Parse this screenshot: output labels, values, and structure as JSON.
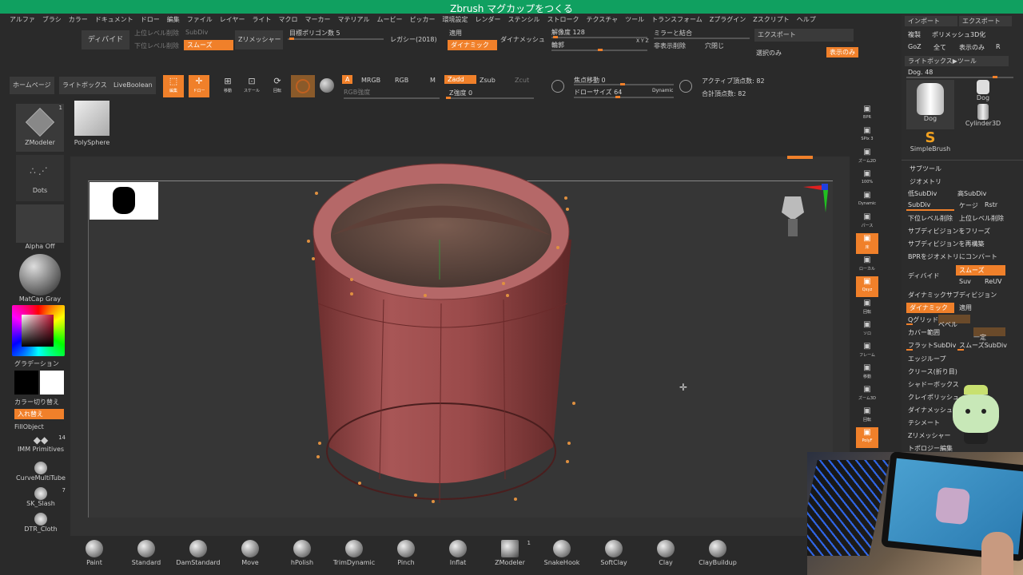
{
  "title_bar": {
    "title": "Zbrush マグカップをつくる",
    "bg": "#10a060"
  },
  "menu": [
    "アルファ",
    "ブラシ",
    "カラー",
    "ドキュメント",
    "ドロー",
    "編集",
    "ファイル",
    "レイヤー",
    "ライト",
    "マクロ",
    "マーカー",
    "マテリアル",
    "ムービー",
    "ピッカー",
    "環境設定",
    "レンダー",
    "ステンシル",
    "ストローク",
    "テクスチャ",
    "ツール",
    "トランスフォーム",
    "Zプラグイン",
    "Zスクリプト",
    "ヘルプ"
  ],
  "toolbar1": {
    "divide": "ディバイド",
    "upper_del": "上位レベル削除",
    "lower_del": "下位レベル削除",
    "subdiv": "SubDiv",
    "smooth": "スムーズ",
    "zremesher": "Zリメッシャー",
    "target_poly": "目標ポリゴン数 5",
    "legacy": "レガシー(2018)",
    "apply": "適用",
    "dynamic": "ダイナミック",
    "dynamesh": "ダイナメッシュ",
    "resolution": "解像度 128",
    "blur": "輪郭",
    "xyz": "X Y Z",
    "mirror_weld": "ミラーと結合",
    "hide_delete": "非表示削除",
    "close_holes": "穴閉じ",
    "export": "エクスポート",
    "selected_only": "選択のみ",
    "visible_only": "表示のみ"
  },
  "toolbar2": {
    "home": "ホームページ",
    "lightbox": "ライトボックス",
    "liveboolean": "LiveBoolean",
    "edit": "編集",
    "draw": "ドロー",
    "move": "移動",
    "scale": "スケール",
    "rotate": "回転",
    "a": "A",
    "mrgb": "MRGB",
    "rgb": "RGB",
    "m": "M",
    "zadd": "Zadd",
    "zsub": "Zsub",
    "zcut": "Zcut",
    "rgb_intensity": "RGB強度",
    "z_intensity": "Z強度 0",
    "focal_shift": "焦点移動 0",
    "draw_size": "ドローサイズ 64",
    "dynamic_lbl": "Dynamic",
    "active_points": "アクティブ頂点数: 82",
    "total_points": "合計頂点数: 82"
  },
  "left": {
    "zmodeler": "ZModeler",
    "zmodeler_badge": "1",
    "polysphere": "PolySphere",
    "dots": "Dots",
    "alpha_off": "Alpha Off",
    "matcap": "MatCap Gray",
    "gradient": "グラデーション",
    "color_switch": "カラー切り替え",
    "swap": "入れ替え",
    "fill_object": "FillObject",
    "imm": "IMM Primitives",
    "imm_badge": "14",
    "curve": "CurveMultiTube",
    "sk_slash": "SK_Slash",
    "sk_badge": "7",
    "dtr": "DTR_Cloth"
  },
  "right_shelf": [
    "BPR",
    "SPix 3",
    "ズーム2D",
    "100%",
    "Dynamic",
    "パース",
    "床",
    "ローカル",
    "Qxyz",
    "回転",
    "ソロ",
    "フレーム",
    "移動",
    "ズーム3D",
    "回転",
    "PolyF"
  ],
  "right_panel": {
    "import": "インポート",
    "export": "エクスポート",
    "clone": "複製",
    "make_polymesh": "ポリメッシュ3D化",
    "goz": "GoZ",
    "all": "全て",
    "visible": "表示のみ",
    "r": "R",
    "lightbox_tool": "ライトボックス▶ツール",
    "dog_slider": "Dog. 48",
    "dog": "Dog",
    "dog_small": "Dog",
    "cylinder3d": "Cylinder3D",
    "simplebrush": "SimpleBrush",
    "subtool": "サブツール",
    "geometry": "ジオメトリ",
    "lower_subdiv": "低SubDiv",
    "higher_subdiv": "高SubDiv",
    "subdiv": "SubDiv",
    "cage": "ケージ",
    "rstr": "Rstr",
    "del_lower": "下位レベル削除",
    "del_higher": "上位レベル削除",
    "freeze_subdiv": "サブディビジョンをフリーズ",
    "reconstruct_subdiv": "サブディビジョンを再構築",
    "convert_bpr": "BPRをジオメトリにコンバート",
    "divide": "ディバイド",
    "smooth": "スムーズ",
    "suv": "Suv",
    "reuv": "ReUV",
    "dynamic_subdiv": "ダイナミックサブディビジョン",
    "dynamic": "ダイナミック",
    "apply": "適用",
    "qgrid": "Qグリッド",
    "bevel": "ベベル",
    "coverage": "カバー範囲",
    "constant": "一定",
    "flat_subdiv": "フラットSubDiv",
    "smooth_subdiv": "スムーズSubDiv",
    "edgeloop": "エッジループ",
    "crease": "クリース(折り目)",
    "shadowbox": "シャドーボックス",
    "claypolish": "クレイポリッシュ",
    "dynamesh": "ダイナメッシュ",
    "tessimate": "テシメート",
    "zremesher": "Zリメッシャー",
    "topology": "トポロジー編集"
  },
  "brushes": [
    "Paint",
    "Standard",
    "DamStandard",
    "Move",
    "hPolish",
    "TrimDynamic",
    "Pinch",
    "Inflat",
    "ZModeler",
    "SnakeHook",
    "SoftClay",
    "Clay",
    "ClayBuildup"
  ],
  "zmodeler_brush_badge": "1",
  "colors": {
    "accent": "#f0802a",
    "title": "#10a060",
    "mesh": "#9a4a4a"
  }
}
